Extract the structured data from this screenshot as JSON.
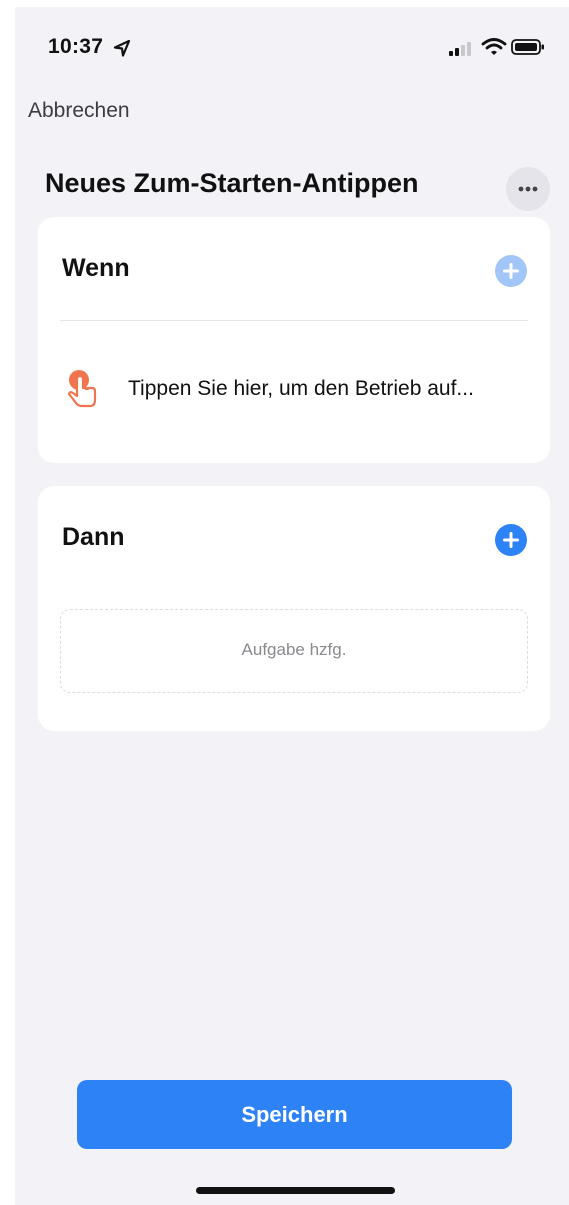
{
  "status_bar": {
    "time": "10:37",
    "location_icon": "location-arrow-icon",
    "signal_icon": "cellular-signal-icon",
    "wifi_icon": "wifi-icon",
    "battery_icon": "battery-icon"
  },
  "header": {
    "cancel_label": "Abbrechen",
    "title": "Neues Zum-Starten-Antippen",
    "more_icon": "ellipsis-icon"
  },
  "when_card": {
    "heading": "Wenn",
    "add_icon": "plus-circle-icon",
    "trigger_icon": "tap-hand-icon",
    "trigger_text": "Tippen Sie hier, um den Betrieb auf..."
  },
  "then_card": {
    "heading": "Dann",
    "add_icon": "plus-circle-icon",
    "add_task_label": "Aufgabe hzfg."
  },
  "footer": {
    "save_label": "Speichern"
  },
  "colors": {
    "accent": "#2d82f6",
    "accent_disabled": "#a3c6f8",
    "trigger_icon": "#f0744e",
    "background": "#f2f2f7"
  }
}
